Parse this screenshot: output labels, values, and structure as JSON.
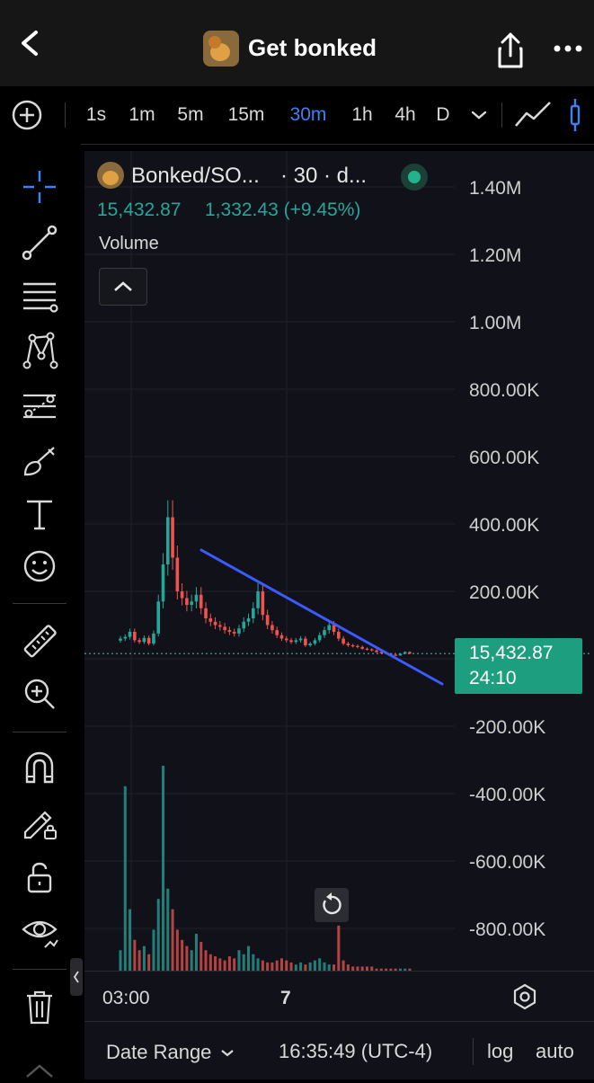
{
  "header": {
    "title": "Get bonked",
    "back_icon": "chevron-left-icon",
    "share_icon": "share-icon",
    "more_icon": "more-icon"
  },
  "timeframes": {
    "items": [
      "1s",
      "1m",
      "5m",
      "15m",
      "30m",
      "1h",
      "4h",
      "D"
    ],
    "selected": "30m",
    "selected_color": "#3b82f6"
  },
  "legend": {
    "symbol": "Bonked/SO...",
    "interval": "· 30 · d...",
    "price": "15,432.87",
    "change": "1,332.43 (+9.45%)",
    "volume_label": "Volume",
    "up_color": "#26a69a",
    "down_color": "#ef5350"
  },
  "price_tag": {
    "price": "15,432.87",
    "countdown": "24:10"
  },
  "time_labels": [
    "03:00",
    "7"
  ],
  "bottom": {
    "date_range": "Date Range",
    "time": "16:35:49 (UTC-4)",
    "log": "log",
    "auto": "auto"
  },
  "chart_data": {
    "type": "candlestick",
    "y_axis_labels": [
      "1.40M",
      "1.20M",
      "1.00M",
      "800.00K",
      "600.00K",
      "400.00K",
      "200.00K",
      "-200.00K",
      "-400.00K",
      "-600.00K",
      "-800.00K"
    ],
    "ylim": [
      -900000,
      1450000
    ],
    "last_price": 15432.87,
    "close": [
      60000,
      65000,
      80000,
      55000,
      50000,
      62000,
      45000,
      75000,
      170000,
      280000,
      420000,
      300000,
      200000,
      180000,
      160000,
      170000,
      190000,
      150000,
      120000,
      110000,
      100000,
      95000,
      85000,
      80000,
      75000,
      90000,
      110000,
      120000,
      150000,
      200000,
      130000,
      100000,
      85000,
      70000,
      60000,
      55000,
      50000,
      55000,
      60000,
      40000,
      45000,
      55000,
      70000,
      85000,
      100000,
      80000,
      60000,
      45000,
      40000,
      38000,
      35000,
      30000,
      28000,
      25000,
      20000,
      18000,
      15000,
      12000,
      10000,
      15000,
      20000,
      15432
    ],
    "volume_relative": [
      0.1,
      0.9,
      0.3,
      0.15,
      0.1,
      0.12,
      0.08,
      0.2,
      0.35,
      1.0,
      0.4,
      0.3,
      0.2,
      0.15,
      0.12,
      0.1,
      0.18,
      0.14,
      0.1,
      0.08,
      0.07,
      0.06,
      0.05,
      0.07,
      0.06,
      0.1,
      0.08,
      0.12,
      0.08,
      0.06,
      0.05,
      0.04,
      0.04,
      0.05,
      0.06,
      0.05,
      0.04,
      0.03,
      0.04,
      0.03,
      0.04,
      0.05,
      0.06,
      0.04,
      0.03,
      0.03,
      0.22,
      0.05,
      0.03,
      0.02,
      0.02,
      0.02,
      0.02,
      0.02,
      0.01,
      0.01,
      0.01,
      0.01,
      0.01,
      0.01,
      0.01,
      0.01
    ]
  }
}
